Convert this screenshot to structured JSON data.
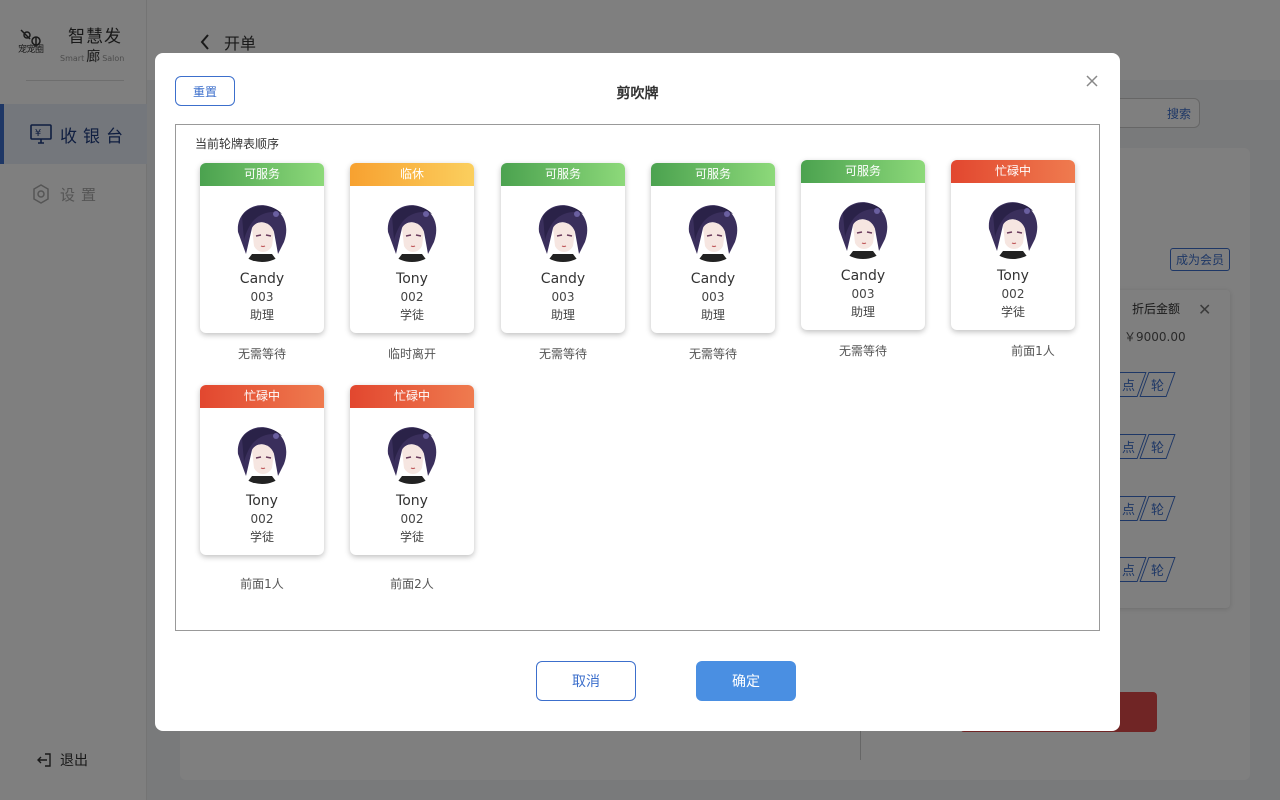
{
  "sidebar": {
    "logo_sub": "宠宠圈",
    "logo_title": "智慧发",
    "logo_en_left": "Smart",
    "logo_en_mid": "廊",
    "logo_en_right": "Salon",
    "nav": [
      {
        "label": "收银台",
        "icon": "cashier-monitor-icon",
        "active": true
      },
      {
        "label": "设置",
        "icon": "gear-icon",
        "active": false
      }
    ],
    "logout_label": "退出"
  },
  "header": {
    "title": "开单"
  },
  "background": {
    "search_label": "搜索",
    "member_label": "成为会员",
    "discount_label": "折后金额",
    "price": "￥9000.00",
    "rows": [
      {
        "point": "点",
        "turn": "轮"
      },
      {
        "point": "点",
        "turn": "轮"
      },
      {
        "point": "点",
        "turn": "轮"
      },
      {
        "point": "点",
        "turn": "轮"
      }
    ]
  },
  "modal": {
    "title": "剪吹牌",
    "reset_label": "重置",
    "queue_label": "当前轮牌表顺序",
    "cancel_label": "取消",
    "confirm_label": "确定",
    "accent_color": "#3c6fcc",
    "staff": [
      {
        "status": "可服务",
        "status_type": "ok",
        "name": "Candy",
        "number": "003",
        "role": "助理",
        "wait": "无需等待"
      },
      {
        "status": "临休",
        "status_type": "rest",
        "name": "Tony",
        "number": "002",
        "role": "学徒",
        "wait": "临时离开"
      },
      {
        "status": "可服务",
        "status_type": "ok",
        "name": "Candy",
        "number": "003",
        "role": "助理",
        "wait": "无需等待"
      },
      {
        "status": "可服务",
        "status_type": "ok",
        "name": "Candy",
        "number": "003",
        "role": "助理",
        "wait": "无需等待"
      },
      {
        "status": "可服务",
        "status_type": "ok",
        "name": "Candy",
        "number": "003",
        "role": "助理",
        "wait": "无需等待"
      },
      {
        "status": "忙碌中",
        "status_type": "busy",
        "name": "Tony",
        "number": "002",
        "role": "学徒",
        "wait": "前面1人"
      },
      {
        "status": "忙碌中",
        "status_type": "busy",
        "name": "Tony",
        "number": "002",
        "role": "学徒",
        "wait": "前面1人"
      },
      {
        "status": "忙碌中",
        "status_type": "busy",
        "name": "Tony",
        "number": "002",
        "role": "学徒",
        "wait": "前面2人"
      }
    ]
  }
}
